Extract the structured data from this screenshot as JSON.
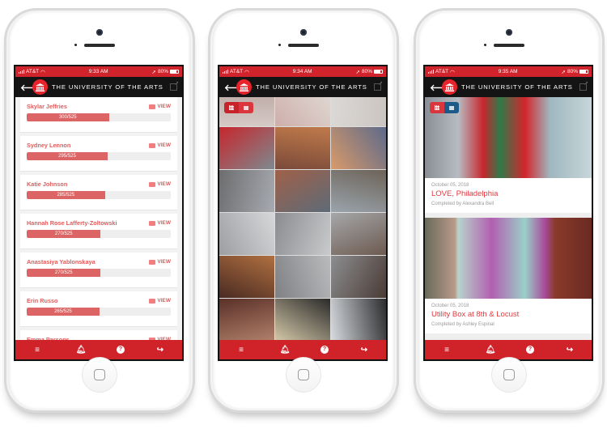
{
  "app": {
    "title": "THE UNIVERSITY OF THE ARTS",
    "carrier": "AT&T",
    "battery": "80%",
    "colors": {
      "brand_red": "#d0232b",
      "header_black": "#141414",
      "progress_red": "#dd6464",
      "accent_blue": "#1c5a8a"
    }
  },
  "tabs": [
    {
      "icon": "menu-icon",
      "glyph": "≡"
    },
    {
      "icon": "bell-icon",
      "glyph": "🔔"
    },
    {
      "icon": "help-icon",
      "glyph": "?"
    },
    {
      "icon": "share-icon",
      "glyph": "↪"
    }
  ],
  "phones": [
    {
      "time": "9:33 AM",
      "view": "leaderboard",
      "students": [
        {
          "name": "Skylar Jeffries",
          "score": "300/525",
          "progress": 0.571,
          "view_label": "VIEW"
        },
        {
          "name": "Sydney Lennon",
          "score": "295/525",
          "progress": 0.562,
          "view_label": "VIEW"
        },
        {
          "name": "Katie Johnson",
          "score": "285/525",
          "progress": 0.543,
          "view_label": "VIEW"
        },
        {
          "name": "Hannah Rose Lafferty-Zoltowski",
          "score": "270/525",
          "progress": 0.514,
          "view_label": "VIEW"
        },
        {
          "name": "Anastasiya Yablonskaya",
          "score": "270/525",
          "progress": 0.514,
          "view_label": "VIEW"
        },
        {
          "name": "Erin Russo",
          "score": "265/525",
          "progress": 0.505,
          "view_label": "VIEW"
        },
        {
          "name": "Emma Parsons",
          "score": "",
          "progress": 0,
          "view_label": "VIEW"
        }
      ]
    },
    {
      "time": "9:34 AM",
      "view": "photo-grid",
      "photos": [
        "selfie-group",
        "selfie-red-shirt",
        "selfie-hand",
        "love-sculpture",
        "selfie-mural",
        "selfie-mural-2",
        "city-hall",
        "selfie-street-car",
        "selfie-street",
        "city-hall-columns",
        "city-hall-selfie",
        "city-hall-group",
        "walnut-street-theatre",
        "city-hall-facade",
        "group-selfie",
        "theatre-pair",
        "selfie-red-tee",
        "selfie-river"
      ]
    },
    {
      "time": "9:35 AM",
      "view": "feed",
      "items": [
        {
          "date": "October 05, 2018",
          "title": "LOVE, Philadelphia",
          "completed_by": "Completed by Alexandra Bell",
          "photo": "love-sculpture"
        },
        {
          "date": "October 05, 2018",
          "title": "Utility Box at 8th & Locust",
          "completed_by": "Completed by Ashley Espinal",
          "photo": "utility-box-roses"
        }
      ]
    }
  ]
}
